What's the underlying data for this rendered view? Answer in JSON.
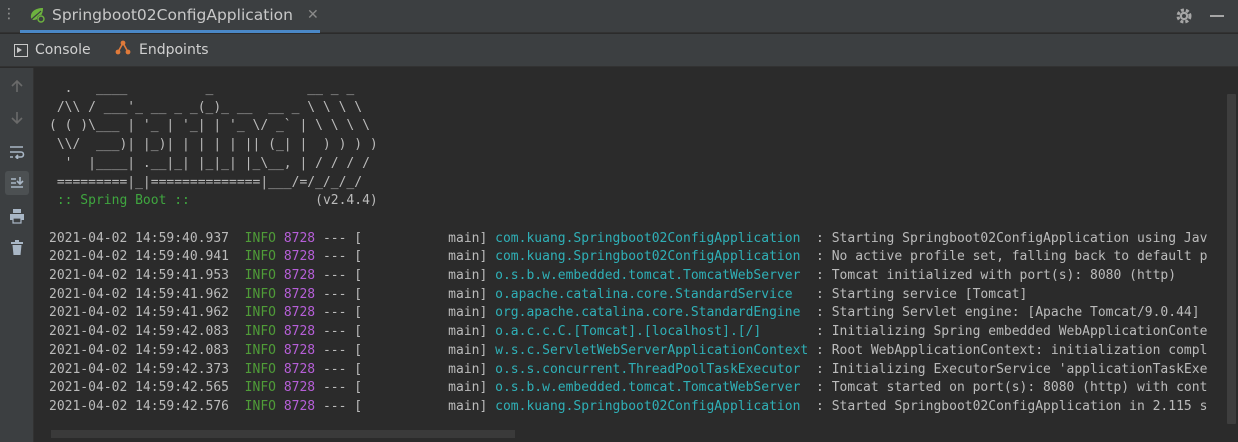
{
  "window": {
    "tab_title": "Springboot02ConfigApplication",
    "close_glyph": "✕",
    "left_dots": "⋮"
  },
  "subtabs": [
    {
      "label": "Console",
      "icon": "console-icon"
    },
    {
      "label": "Endpoints",
      "icon": "endpoints-icon"
    }
  ],
  "toolbar_icons": [
    "arrow-up-icon",
    "arrow-down-icon",
    "soft-wrap-icon",
    "scroll-to-end-icon",
    "print-icon",
    "trash-icon"
  ],
  "banner": [
    "  .   ____          _            __ _ _",
    " /\\\\ / ___'_ __ _ _(_)_ __  __ _ \\ \\ \\ \\",
    "( ( )\\___ | '_ | '_| | '_ \\/ _` | \\ \\ \\ \\",
    " \\\\/  ___)| |_)| | | | | || (_| |  ) ) ) )",
    "  '  |____| .__|_| |_|_| |_\\__, | / / / /",
    " =========|_|==============|___/=/_/_/_/"
  ],
  "spring_label": " :: Spring Boot :: ",
  "spring_version": "               (v2.4.4)",
  "logs": [
    {
      "ts": "2021-04-02 14:59:40.937",
      "level": "INFO",
      "pid": "8728",
      "thread": "--- [           main]",
      "logger": "com.kuang.Springboot02ConfigApplication ",
      "msg": " : Starting Springboot02ConfigApplication using Jav"
    },
    {
      "ts": "2021-04-02 14:59:40.941",
      "level": "INFO",
      "pid": "8728",
      "thread": "--- [           main]",
      "logger": "com.kuang.Springboot02ConfigApplication ",
      "msg": " : No active profile set, falling back to default p"
    },
    {
      "ts": "2021-04-02 14:59:41.953",
      "level": "INFO",
      "pid": "8728",
      "thread": "--- [           main]",
      "logger": "o.s.b.w.embedded.tomcat.TomcatWebServer ",
      "msg": " : Tomcat initialized with port(s): 8080 (http)"
    },
    {
      "ts": "2021-04-02 14:59:41.962",
      "level": "INFO",
      "pid": "8728",
      "thread": "--- [           main]",
      "logger": "o.apache.catalina.core.StandardService  ",
      "msg": " : Starting service [Tomcat]"
    },
    {
      "ts": "2021-04-02 14:59:41.962",
      "level": "INFO",
      "pid": "8728",
      "thread": "--- [           main]",
      "logger": "org.apache.catalina.core.StandardEngine ",
      "msg": " : Starting Servlet engine: [Apache Tomcat/9.0.44]"
    },
    {
      "ts": "2021-04-02 14:59:42.083",
      "level": "INFO",
      "pid": "8728",
      "thread": "--- [           main]",
      "logger": "o.a.c.c.C.[Tomcat].[localhost].[/]      ",
      "msg": " : Initializing Spring embedded WebApplicationConte"
    },
    {
      "ts": "2021-04-02 14:59:42.083",
      "level": "INFO",
      "pid": "8728",
      "thread": "--- [           main]",
      "logger": "w.s.c.ServletWebServerApplicationContext",
      "msg": " : Root WebApplicationContext: initialization compl"
    },
    {
      "ts": "2021-04-02 14:59:42.373",
      "level": "INFO",
      "pid": "8728",
      "thread": "--- [           main]",
      "logger": "o.s.s.concurrent.ThreadPoolTaskExecutor ",
      "msg": " : Initializing ExecutorService 'applicationTaskExe"
    },
    {
      "ts": "2021-04-02 14:59:42.565",
      "level": "INFO",
      "pid": "8728",
      "thread": "--- [           main]",
      "logger": "o.s.b.w.embedded.tomcat.TomcatWebServer ",
      "msg": " : Tomcat started on port(s): 8080 (http) with cont"
    },
    {
      "ts": "2021-04-02 14:59:42.576",
      "level": "INFO",
      "pid": "8728",
      "thread": "--- [           main]",
      "logger": "com.kuang.Springboot02ConfigApplication ",
      "msg": " : Started Springboot02ConfigApplication in 2.115 s"
    }
  ],
  "colors": {
    "accent": "#4a88c7",
    "spring_green": "#3fa63f",
    "info_green": "#4f9c38",
    "pid_magenta": "#b65fd8",
    "logger_cyan": "#2fb0b7"
  }
}
